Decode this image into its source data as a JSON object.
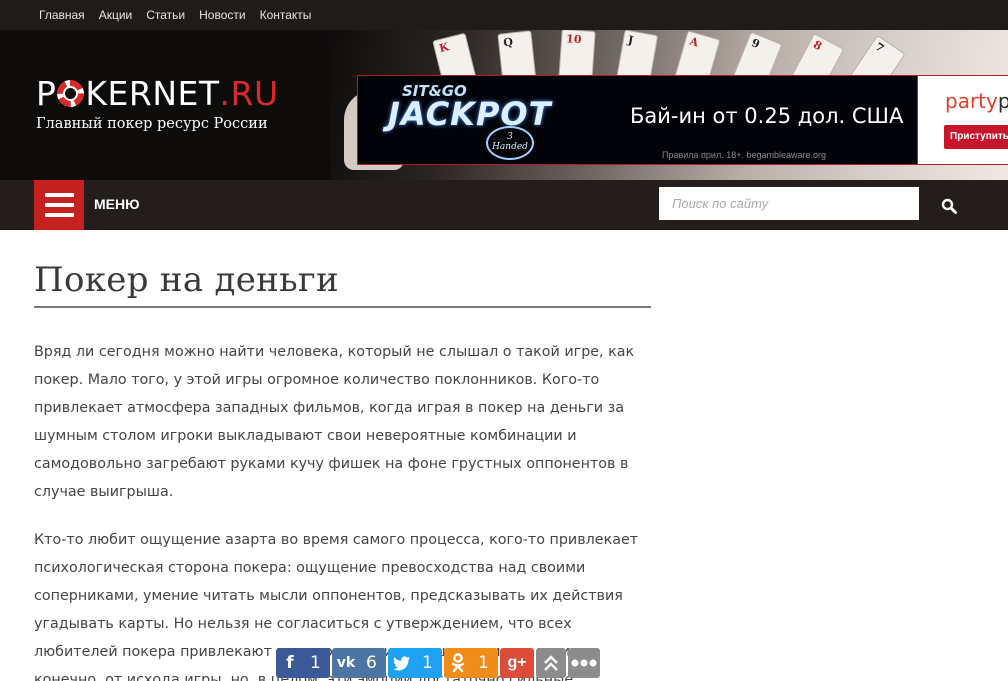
{
  "topnav": {
    "items": [
      "Главная",
      "Акции",
      "Статьи",
      "Новости",
      "Контакты"
    ]
  },
  "logo": {
    "part1": "P",
    "part2": "KERNET",
    "part3": ".RU",
    "tagline": "Главный покер ресурс России"
  },
  "banner": {
    "sitgo": "SIT&GO",
    "jackpot": "JACKPOT",
    "badge_top": "3",
    "badge_bottom": "Handed",
    "buyin": "Бай-ин от 0.25 дол. США",
    "rules": "Правила прил. 18+. begambleaware.org",
    "brand_a": "party",
    "brand_b": "p",
    "cta": "Приступить"
  },
  "menubar": {
    "menu_label": "МЕНЮ",
    "search_placeholder": "Поиск по сайту"
  },
  "article": {
    "title": "Покер на деньги",
    "paragraphs": [
      "Вряд ли сегодня можно найти человека, который не слышал о такой игре, как покер. Мало того, у этой игры огромное количество поклонников. Кого-то привлекает атмосфера западных фильмов, когда играя в покер на деньги за шумным столом игроки выкладывают свои невероятные комбинации и самодовольно загребают руками кучу фишек на фоне грустных оппонентов в случае выигрыша.",
      "Кто-то любит ощущение азарта во время самого процесса, кого-то привлекает психологическая сторона покера: ощущение превосходства над своими соперниками, умение читать мысли оппонентов, предсказывать их действия угадывать карты. Но нельзя не согласиться с утверждением, что всех любителей покера привлекают именно эмоции, хорошие или нет зависит, конечно, от исхода игры, но, в целом, эти эмоции достаточно сильные."
    ]
  },
  "share": {
    "facebook_count": "1",
    "vk_count": "6",
    "twitter_count": "1",
    "ok_count": "1",
    "gplus_label": "g+"
  },
  "colors": {
    "accent_red": "#c4211f",
    "dark_bar": "#231e1c",
    "facebook": "#3b5998",
    "vk": "#4c75a3",
    "twitter": "#1da1f2",
    "odnoklassniki": "#f08c1a",
    "gplus": "#dd4b39"
  }
}
